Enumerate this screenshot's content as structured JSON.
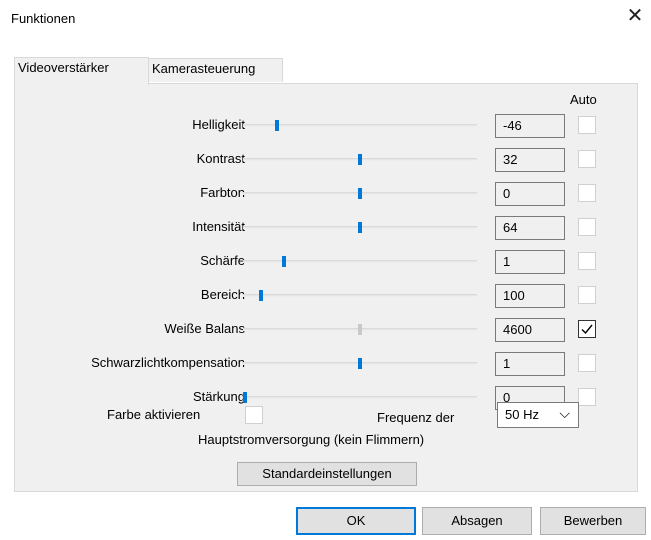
{
  "window": {
    "title": "Funktionen",
    "close_glyph": "✕"
  },
  "tabs": [
    {
      "label": "Videoverstärker",
      "active": true
    },
    {
      "label": "Kamerasteuerung",
      "active": false
    }
  ],
  "auto_header": "Auto",
  "sliders": [
    {
      "label": "Helligkeit",
      "value": "-46",
      "position": 0.14,
      "enabled": true,
      "auto": false
    },
    {
      "label": "Kontrast",
      "value": "32",
      "position": 0.5,
      "enabled": true,
      "auto": false
    },
    {
      "label": "Farbton",
      "value": "0",
      "position": 0.5,
      "enabled": true,
      "auto": false
    },
    {
      "label": "Intensität",
      "value": "64",
      "position": 0.5,
      "enabled": true,
      "auto": false
    },
    {
      "label": "Schärfe",
      "value": "1",
      "position": 0.17,
      "enabled": true,
      "auto": false
    },
    {
      "label": "Bereich",
      "value": "100",
      "position": 0.07,
      "enabled": true,
      "auto": false
    },
    {
      "label": "Weiße Balans",
      "value": "4600",
      "position": 0.5,
      "enabled": false,
      "auto": true
    },
    {
      "label": "Schwarzlichtkompensation",
      "value": "1",
      "position": 0.5,
      "enabled": true,
      "auto": false
    },
    {
      "label": "Stärkung",
      "value": "0",
      "position": 0.0,
      "enabled": true,
      "auto": false
    }
  ],
  "color_enable": {
    "label": "Farbe aktivieren",
    "checked": false
  },
  "frequency": {
    "label_line1": "Frequenz der",
    "label_line2": "Hauptstromversorgung (kein Flimmern)",
    "selected": "50 Hz",
    "chevron": "⌵"
  },
  "defaults_button": "Standardeinstellungen",
  "footer": {
    "ok": "OK",
    "cancel": "Absagen",
    "apply": "Bewerben"
  },
  "colors": {
    "accent": "#0078d7",
    "panel": "#f0f0f0",
    "button": "#e1e1e1"
  }
}
